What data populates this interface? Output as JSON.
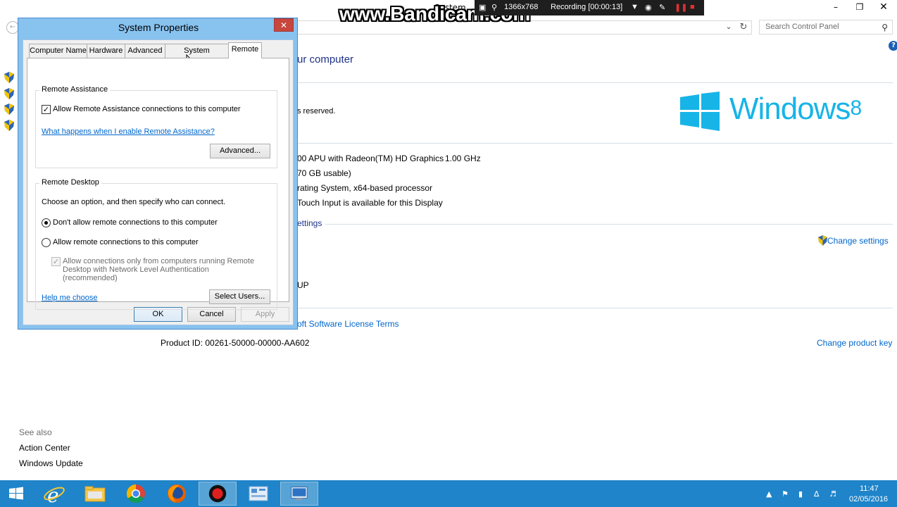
{
  "background_window": {
    "title": "System",
    "search_placeholder": "Search Control Panel",
    "heading": "ur computer",
    "copyright_fragment": "s reserved.",
    "logo_text": "Windows",
    "logo_version": "8",
    "processor_fragment": "00 APU with Radeon(TM) HD Graphics",
    "processor_speed": "1.00 GHz",
    "memory_fragment": "70 GB usable)",
    "system_type_fragment": "rating System, x64-based processor",
    "pen_touch_fragment": "Touch Input is available for this Display",
    "settings_group_fragment": "ettings",
    "change_settings": "Change settings",
    "workgroup_fragment": "UP",
    "license_fragment": "oft Software License Terms",
    "product_id": "Product ID:  00261-50000-00000-AA602",
    "change_product_key": "Change product key",
    "see_also": "See also",
    "see_also_links": [
      "Action Center",
      "Windows Update"
    ]
  },
  "recording_overlay": {
    "watermark": "www.Bandicam.com",
    "resolution": "1366x768",
    "status": "Recording [00:00:13]"
  },
  "dialog": {
    "title": "System Properties",
    "tabs": [
      "Computer Name",
      "Hardware",
      "Advanced",
      "System Protection",
      "Remote"
    ],
    "active_tab": "Remote",
    "remote_assistance": {
      "group_title": "Remote Assistance",
      "allow_label": "Allow Remote Assistance connections to this computer",
      "allow_checked": true,
      "help_link": "What happens when I enable Remote Assistance?",
      "advanced_button": "Advanced..."
    },
    "remote_desktop": {
      "group_title": "Remote Desktop",
      "instruction": "Choose an option, and then specify who can connect.",
      "option_dont_allow": "Don't allow remote connections to this computer",
      "option_allow": "Allow remote connections to this computer",
      "selected_option": "dont_allow",
      "nla_label": "Allow connections only from computers running Remote Desktop with Network Level Authentication (recommended)",
      "nla_checked": true,
      "help_link": "Help me choose",
      "select_users_button": "Select Users..."
    },
    "buttons": {
      "ok": "OK",
      "cancel": "Cancel",
      "apply": "Apply"
    }
  },
  "taskbar": {
    "time": "11:47",
    "date": "02/05/2016"
  }
}
